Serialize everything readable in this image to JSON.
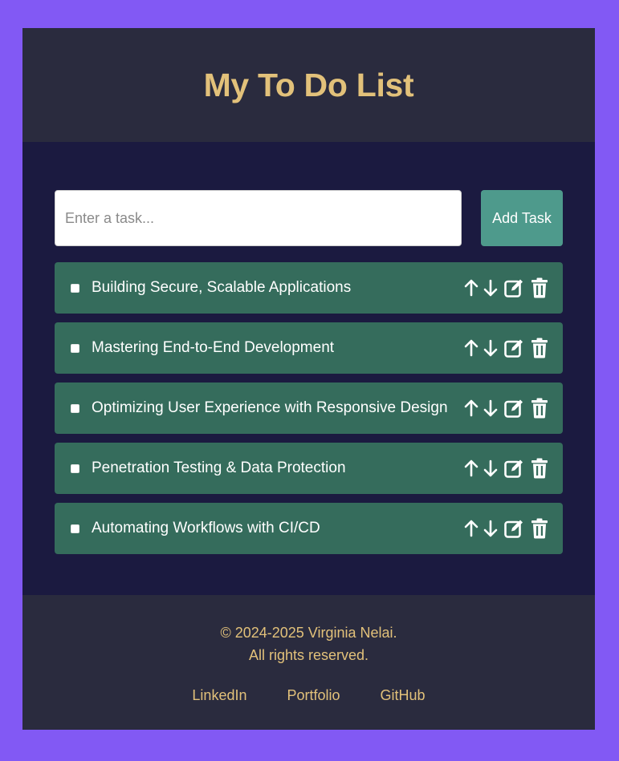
{
  "header": {
    "title": "My To Do List"
  },
  "form": {
    "placeholder": "Enter a task...",
    "value": "",
    "add_label": "Add Task"
  },
  "tasks": [
    {
      "text": "Building Secure, Scalable Applications",
      "checked": false
    },
    {
      "text": "Mastering End-to-End Development",
      "checked": false
    },
    {
      "text": "Optimizing User Experience with Responsive Design",
      "checked": false
    },
    {
      "text": "Penetration Testing & Data Protection",
      "checked": false
    },
    {
      "text": "Automating Workflows with CI/CD",
      "checked": false
    }
  ],
  "task_actions": {
    "icons": [
      "arrow-up-icon",
      "arrow-down-icon",
      "edit-icon",
      "trash-icon"
    ]
  },
  "footer": {
    "copyright_line1": "© 2024-2025 Virginia Nelai.",
    "copyright_line2": "All rights reserved.",
    "links": [
      {
        "label": "LinkedIn"
      },
      {
        "label": "Portfolio"
      },
      {
        "label": "GitHub"
      }
    ]
  },
  "colors": {
    "page_bg": "#8259f4",
    "panel_bg": "#1b1a40",
    "header_bg": "#2a2b3e",
    "accent_gold": "#e2c17a",
    "task_bg": "#356c5c",
    "button_bg": "#4e9a8c"
  }
}
